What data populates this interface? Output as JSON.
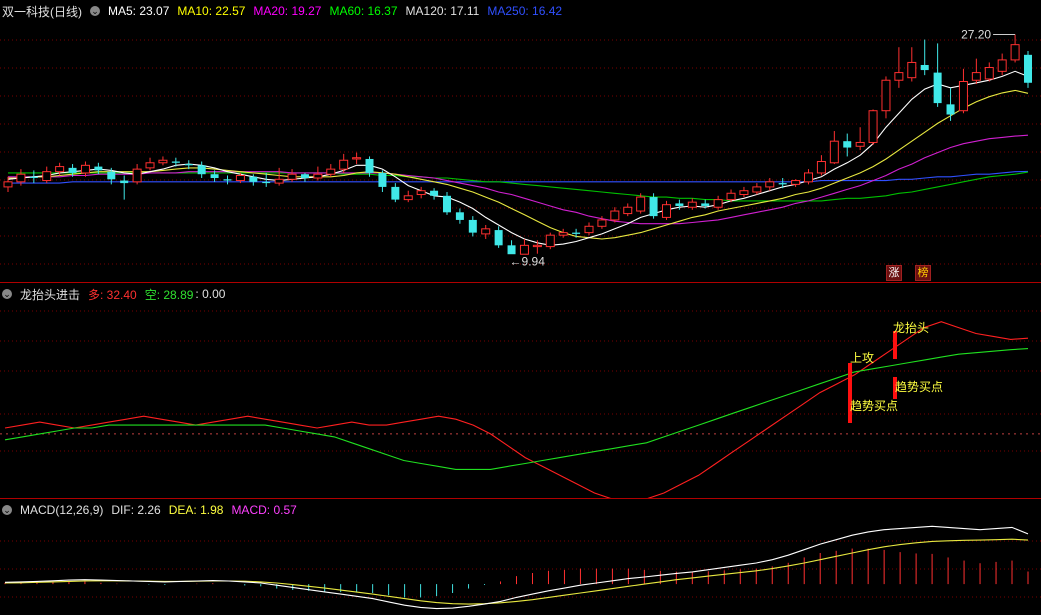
{
  "main": {
    "title": "双一科技(日线)",
    "ma": [
      {
        "label": "MA5: 23.07",
        "color": "#ffffff"
      },
      {
        "label": "MA10: 22.57",
        "color": "#ffff00"
      },
      {
        "label": "MA20: 19.27",
        "color": "#ff00ff"
      },
      {
        "label": "MA60: 16.37",
        "color": "#00ff00"
      },
      {
        "label": "MA120: 17.11",
        "color": "#e0e0e0"
      },
      {
        "label": "MA250: 16.42",
        "color": "#3050ff"
      }
    ],
    "high_label": "27.20",
    "low_label": "9.94",
    "badges": [
      "涨",
      "榜"
    ]
  },
  "ind": {
    "title": "龙抬头进击",
    "long_label": "多: 32.40",
    "short_label": "空: 28.89",
    "zero_label": ": 0.00",
    "signals": {
      "up_attack": "上攻",
      "trend_buy_1": "趋势买点",
      "dragon": "龙抬头",
      "trend_buy_2": "趋势买点"
    }
  },
  "macd": {
    "title": "MACD(12,26,9)",
    "dif_label": "DIF: 2.26",
    "dea_label": "DEA: 1.98",
    "macd_label": "MACD: 0.57"
  },
  "chart_data": [
    {
      "type": "candlestick",
      "title": "双一科技(日线)",
      "ylim": [
        8.5,
        28.5
      ],
      "candles": [
        [
          15.2,
          15.6,
          16.0,
          14.8
        ],
        [
          15.6,
          16.2,
          16.6,
          15.3
        ],
        [
          16.0,
          15.9,
          16.5,
          15.5
        ],
        [
          15.7,
          16.4,
          16.8,
          15.5
        ],
        [
          16.4,
          16.8,
          17.1,
          16.1
        ],
        [
          16.7,
          16.3,
          17.0,
          16.0
        ],
        [
          16.3,
          16.9,
          17.2,
          16.0
        ],
        [
          16.8,
          16.5,
          17.1,
          16.2
        ],
        [
          16.4,
          15.8,
          16.7,
          15.4
        ],
        [
          15.7,
          15.5,
          16.1,
          14.2
        ],
        [
          15.6,
          16.6,
          17.0,
          15.4
        ],
        [
          16.7,
          17.1,
          17.5,
          16.5
        ],
        [
          17.1,
          17.3,
          17.6,
          16.9
        ],
        [
          17.2,
          17.1,
          17.5,
          16.8
        ],
        [
          17.0,
          16.9,
          17.3,
          16.6
        ],
        [
          16.9,
          16.2,
          17.2,
          15.9
        ],
        [
          16.2,
          15.9,
          16.5,
          15.6
        ],
        [
          15.8,
          15.7,
          16.1,
          15.4
        ],
        [
          15.7,
          16.1,
          16.3,
          15.5
        ],
        [
          16.0,
          15.6,
          16.2,
          15.3
        ],
        [
          15.6,
          15.5,
          16.3,
          15.2
        ],
        [
          15.5,
          15.8,
          16.7,
          15.3
        ],
        [
          15.8,
          16.2,
          16.6,
          15.6
        ],
        [
          16.2,
          15.9,
          16.3,
          15.6
        ],
        [
          15.9,
          16.2,
          16.8,
          15.7
        ],
        [
          16.2,
          16.6,
          17.0,
          16.0
        ],
        [
          16.6,
          17.3,
          17.8,
          16.3
        ],
        [
          17.4,
          17.5,
          17.9,
          17.0
        ],
        [
          17.4,
          16.3,
          17.6,
          16.0
        ],
        [
          16.3,
          15.2,
          16.5,
          14.8
        ],
        [
          15.2,
          14.2,
          15.5,
          14.0
        ],
        [
          14.2,
          14.5,
          14.9,
          14.0
        ],
        [
          14.6,
          14.9,
          15.2,
          14.3
        ],
        [
          14.9,
          14.5,
          15.1,
          14.2
        ],
        [
          14.5,
          13.2,
          14.8,
          13.0
        ],
        [
          13.2,
          12.6,
          13.5,
          12.3
        ],
        [
          12.6,
          11.6,
          12.9,
          11.3
        ],
        [
          11.5,
          11.9,
          12.2,
          11.1
        ],
        [
          11.8,
          10.6,
          12.1,
          10.4
        ],
        [
          10.6,
          9.9,
          11.0,
          9.94
        ],
        [
          9.9,
          10.6,
          11.1,
          9.94
        ],
        [
          10.5,
          10.6,
          11.0,
          9.94
        ],
        [
          10.5,
          11.4,
          11.6,
          10.3
        ],
        [
          11.4,
          11.6,
          11.9,
          11.2
        ],
        [
          11.6,
          11.5,
          11.9,
          11.2
        ],
        [
          11.6,
          12.1,
          12.4,
          11.4
        ],
        [
          12.1,
          12.6,
          12.9,
          11.9
        ],
        [
          12.6,
          13.3,
          13.6,
          12.4
        ],
        [
          13.1,
          13.6,
          13.9,
          12.9
        ],
        [
          13.3,
          14.4,
          14.7,
          13.1
        ],
        [
          14.4,
          12.9,
          14.7,
          12.7
        ],
        [
          12.8,
          13.8,
          14.1,
          12.6
        ],
        [
          13.9,
          13.7,
          14.2,
          13.4
        ],
        [
          13.6,
          14.0,
          14.3,
          13.4
        ],
        [
          13.9,
          13.7,
          14.2,
          13.5
        ],
        [
          13.6,
          14.2,
          14.5,
          13.4
        ],
        [
          14.2,
          14.7,
          15.0,
          14.0
        ],
        [
          14.6,
          14.9,
          15.2,
          14.4
        ],
        [
          14.8,
          15.2,
          15.5,
          14.6
        ],
        [
          15.2,
          15.6,
          15.9,
          14.9
        ],
        [
          15.5,
          15.4,
          15.9,
          15.1
        ],
        [
          15.4,
          15.7,
          15.8,
          15.2
        ],
        [
          15.6,
          16.3,
          16.6,
          15.4
        ],
        [
          16.3,
          17.2,
          17.7,
          16.1
        ],
        [
          17.1,
          18.8,
          19.6,
          17.0
        ],
        [
          18.8,
          18.3,
          19.4,
          17.6
        ],
        [
          18.4,
          18.7,
          19.9,
          18.1
        ],
        [
          18.7,
          21.2,
          21.3,
          18.5
        ],
        [
          21.2,
          23.6,
          23.9,
          20.6
        ],
        [
          23.6,
          24.2,
          26.2,
          23.0
        ],
        [
          23.8,
          25.0,
          26.2,
          23.5
        ],
        [
          24.8,
          24.4,
          26.8,
          24.0
        ],
        [
          24.2,
          21.8,
          26.5,
          21.5
        ],
        [
          21.7,
          20.9,
          23.0,
          20.4
        ],
        [
          21.2,
          23.5,
          24.5,
          21.0
        ],
        [
          23.6,
          24.2,
          25.3,
          23.3
        ],
        [
          23.7,
          24.6,
          25.0,
          23.5
        ],
        [
          24.3,
          25.2,
          25.7,
          24.0
        ],
        [
          25.2,
          26.4,
          27.2,
          25.0
        ],
        [
          25.6,
          23.4,
          25.9,
          23.0
        ]
      ],
      "ma5": [
        15.8,
        15.9,
        16.0,
        16.1,
        16.3,
        16.4,
        16.5,
        16.6,
        16.5,
        16.3,
        16.2,
        16.4,
        16.6,
        16.9,
        17.0,
        16.9,
        16.7,
        16.4,
        16.2,
        16.0,
        15.8,
        15.7,
        15.8,
        15.9,
        16.0,
        16.2,
        16.5,
        16.9,
        16.9,
        16.6,
        16.0,
        15.3,
        14.9,
        14.5,
        14.4,
        14.0,
        13.5,
        12.8,
        12.2,
        11.6,
        11.1,
        10.8,
        10.6,
        10.7,
        10.9,
        11.2,
        11.5,
        11.9,
        12.3,
        12.8,
        13.1,
        13.4,
        13.6,
        13.7,
        13.6,
        13.8,
        14.1,
        14.3,
        14.6,
        14.9,
        15.2,
        15.4,
        15.7,
        16.0,
        16.6,
        17.1,
        17.7,
        18.6,
        19.9,
        21.0,
        22.1,
        22.9,
        23.3,
        23.0,
        23.2,
        23.4,
        23.6,
        23.9,
        24.3,
        23.9
      ],
      "ma10": [
        15.9,
        15.9,
        16.0,
        16.0,
        16.1,
        16.2,
        16.3,
        16.4,
        16.4,
        16.4,
        16.4,
        16.4,
        16.5,
        16.6,
        16.7,
        16.7,
        16.6,
        16.5,
        16.4,
        16.3,
        16.2,
        16.1,
        16.0,
        16.0,
        16.0,
        16.0,
        16.1,
        16.3,
        16.4,
        16.3,
        16.2,
        16.0,
        15.8,
        15.6,
        15.4,
        15.1,
        14.8,
        14.4,
        14.0,
        13.5,
        13.0,
        12.5,
        12.0,
        11.6,
        11.3,
        11.2,
        11.1,
        11.2,
        11.4,
        11.6,
        11.9,
        12.2,
        12.5,
        12.8,
        13.0,
        13.3,
        13.5,
        13.7,
        13.9,
        14.1,
        14.3,
        14.6,
        14.8,
        15.1,
        15.5,
        15.9,
        16.3,
        16.8,
        17.4,
        18.1,
        18.8,
        19.5,
        20.2,
        20.8,
        21.4,
        21.9,
        22.3,
        22.6,
        22.8,
        22.57
      ],
      "ma20": [
        16.0,
        16.0,
        16.0,
        16.0,
        16.0,
        16.1,
        16.1,
        16.2,
        16.2,
        16.2,
        16.2,
        16.3,
        16.3,
        16.3,
        16.4,
        16.4,
        16.4,
        16.4,
        16.4,
        16.4,
        16.4,
        16.4,
        16.3,
        16.3,
        16.3,
        16.3,
        16.3,
        16.3,
        16.3,
        16.3,
        16.2,
        16.1,
        16.0,
        15.9,
        15.7,
        15.5,
        15.3,
        15.1,
        14.8,
        14.6,
        14.3,
        14.0,
        13.7,
        13.4,
        13.2,
        12.9,
        12.7,
        12.5,
        12.4,
        12.3,
        12.3,
        12.3,
        12.3,
        12.4,
        12.5,
        12.6,
        12.8,
        13.0,
        13.2,
        13.4,
        13.6,
        13.9,
        14.1,
        14.4,
        14.7,
        15.0,
        15.3,
        15.7,
        16.1,
        16.6,
        17.0,
        17.5,
        17.9,
        18.3,
        18.6,
        18.8,
        19.0,
        19.1,
        19.2,
        19.27
      ],
      "ma60": [
        16.3,
        16.3,
        16.3,
        16.3,
        16.3,
        16.3,
        16.3,
        16.3,
        16.3,
        16.3,
        16.3,
        16.3,
        16.3,
        16.3,
        16.3,
        16.3,
        16.3,
        16.3,
        16.3,
        16.3,
        16.3,
        16.3,
        16.3,
        16.3,
        16.3,
        16.3,
        16.2,
        16.2,
        16.2,
        16.1,
        16.1,
        16.0,
        16.0,
        15.9,
        15.9,
        15.8,
        15.7,
        15.6,
        15.6,
        15.5,
        15.4,
        15.3,
        15.2,
        15.1,
        15.0,
        14.9,
        14.8,
        14.7,
        14.6,
        14.5,
        14.4,
        14.4,
        14.3,
        14.3,
        14.2,
        14.2,
        14.1,
        14.1,
        14.1,
        14.1,
        14.1,
        14.1,
        14.1,
        14.1,
        14.2,
        14.3,
        14.3,
        14.4,
        14.5,
        14.7,
        14.8,
        15.0,
        15.2,
        15.4,
        15.6,
        15.8,
        16.0,
        16.1,
        16.2,
        16.37
      ],
      "ma250": [
        15.5,
        15.5,
        15.5,
        15.5,
        15.5,
        15.6,
        15.6,
        15.6,
        15.6,
        15.6,
        15.6,
        15.6,
        15.6,
        15.6,
        15.6,
        15.6,
        15.6,
        15.6,
        15.6,
        15.6,
        15.6,
        15.6,
        15.6,
        15.6,
        15.6,
        15.6,
        15.6,
        15.6,
        15.6,
        15.6,
        15.6,
        15.6,
        15.6,
        15.6,
        15.6,
        15.6,
        15.6,
        15.6,
        15.6,
        15.6,
        15.6,
        15.6,
        15.6,
        15.6,
        15.6,
        15.6,
        15.6,
        15.6,
        15.6,
        15.6,
        15.6,
        15.6,
        15.6,
        15.6,
        15.6,
        15.6,
        15.6,
        15.6,
        15.6,
        15.6,
        15.6,
        15.6,
        15.6,
        15.7,
        15.7,
        15.7,
        15.7,
        15.7,
        15.7,
        15.8,
        15.8,
        15.9,
        16.0,
        16.0,
        16.1,
        16.2,
        16.2,
        16.3,
        16.4,
        16.42
      ]
    },
    {
      "type": "line",
      "title": "龙抬头进击",
      "ylim": [
        -20,
        45
      ],
      "series": [
        {
          "name": "多",
          "color": "#ff2020",
          "values": [
            2,
            3,
            4,
            3,
            2,
            3,
            4,
            5,
            6,
            5,
            4,
            3,
            4,
            5,
            6,
            5,
            4,
            3,
            2,
            3,
            4,
            3,
            3,
            4,
            5,
            6,
            5,
            3,
            0,
            -4,
            -8,
            -11,
            -14,
            -17,
            -20,
            -22,
            -23,
            -22,
            -20,
            -17,
            -14,
            -10,
            -6,
            -2,
            2,
            6,
            10,
            14,
            17,
            20,
            24,
            28,
            32,
            36,
            38,
            36,
            34,
            33,
            32,
            32.4
          ]
        },
        {
          "name": "空",
          "color": "#20e020",
          "values": [
            -2,
            -1,
            0,
            1,
            2,
            2,
            3,
            3,
            3,
            3,
            3,
            3,
            3,
            3,
            3,
            3,
            2,
            1,
            0,
            -1,
            -3,
            -5,
            -7,
            -9,
            -10,
            -11,
            -12,
            -12,
            -12,
            -11,
            -10,
            -9,
            -8,
            -7,
            -6,
            -5,
            -4,
            -3,
            -1,
            1,
            3,
            5,
            7,
            9,
            11,
            13,
            15,
            17,
            19,
            21,
            22,
            23,
            24,
            25,
            26,
            27,
            27.5,
            28,
            28.5,
            28.89
          ]
        }
      ]
    },
    {
      "type": "macd",
      "title": "MACD(12,26,9)",
      "ylim": [
        -1.3,
        3.2
      ],
      "dif": [
        0.08,
        0.1,
        0.12,
        0.15,
        0.18,
        0.2,
        0.18,
        0.16,
        0.14,
        0.12,
        0.1,
        0.12,
        0.14,
        0.16,
        0.14,
        0.1,
        0.05,
        -0.05,
        -0.15,
        -0.25,
        -0.35,
        -0.45,
        -0.55,
        -0.65,
        -0.8,
        -0.95,
        -1.05,
        -1.1,
        -1.08,
        -1.0,
        -0.9,
        -0.78,
        -0.6,
        -0.45,
        -0.3,
        -0.18,
        -0.05,
        0.05,
        0.15,
        0.25,
        0.32,
        0.4,
        0.48,
        0.55,
        0.65,
        0.75,
        0.85,
        0.95,
        1.1,
        1.3,
        1.55,
        1.8,
        2.0,
        2.2,
        2.35,
        2.45,
        2.5,
        2.55,
        2.6,
        2.55,
        2.5,
        2.45,
        2.5,
        2.55,
        2.26
      ],
      "dea": [
        0.05,
        0.06,
        0.08,
        0.1,
        0.12,
        0.14,
        0.15,
        0.15,
        0.14,
        0.13,
        0.12,
        0.12,
        0.13,
        0.14,
        0.14,
        0.13,
        0.1,
        0.05,
        -0.02,
        -0.1,
        -0.18,
        -0.27,
        -0.36,
        -0.45,
        -0.55,
        -0.65,
        -0.75,
        -0.83,
        -0.88,
        -0.9,
        -0.88,
        -0.84,
        -0.78,
        -0.7,
        -0.6,
        -0.5,
        -0.4,
        -0.3,
        -0.2,
        -0.1,
        0.0,
        0.1,
        0.2,
        0.28,
        0.36,
        0.44,
        0.52,
        0.6,
        0.7,
        0.82,
        0.95,
        1.1,
        1.25,
        1.4,
        1.55,
        1.68,
        1.78,
        1.86,
        1.92,
        1.95,
        1.97,
        1.98,
        2.0,
        2.02,
        1.98
      ],
      "hist": [
        0.06,
        0.08,
        0.08,
        0.1,
        0.12,
        0.12,
        0.06,
        0.02,
        0.0,
        -0.02,
        -0.04,
        0.0,
        0.02,
        0.04,
        0.0,
        -0.06,
        -0.1,
        -0.2,
        -0.26,
        -0.3,
        -0.34,
        -0.36,
        -0.38,
        -0.4,
        -0.5,
        -0.6,
        -0.6,
        -0.54,
        -0.4,
        -0.2,
        -0.04,
        0.12,
        0.36,
        0.5,
        0.6,
        0.64,
        0.7,
        0.7,
        0.7,
        0.7,
        0.64,
        0.6,
        0.56,
        0.54,
        0.58,
        0.62,
        0.66,
        0.7,
        0.8,
        0.96,
        1.2,
        1.4,
        1.5,
        1.6,
        1.6,
        1.54,
        1.44,
        1.38,
        1.36,
        1.2,
        1.06,
        0.94,
        1.0,
        1.06,
        0.57
      ]
    }
  ]
}
